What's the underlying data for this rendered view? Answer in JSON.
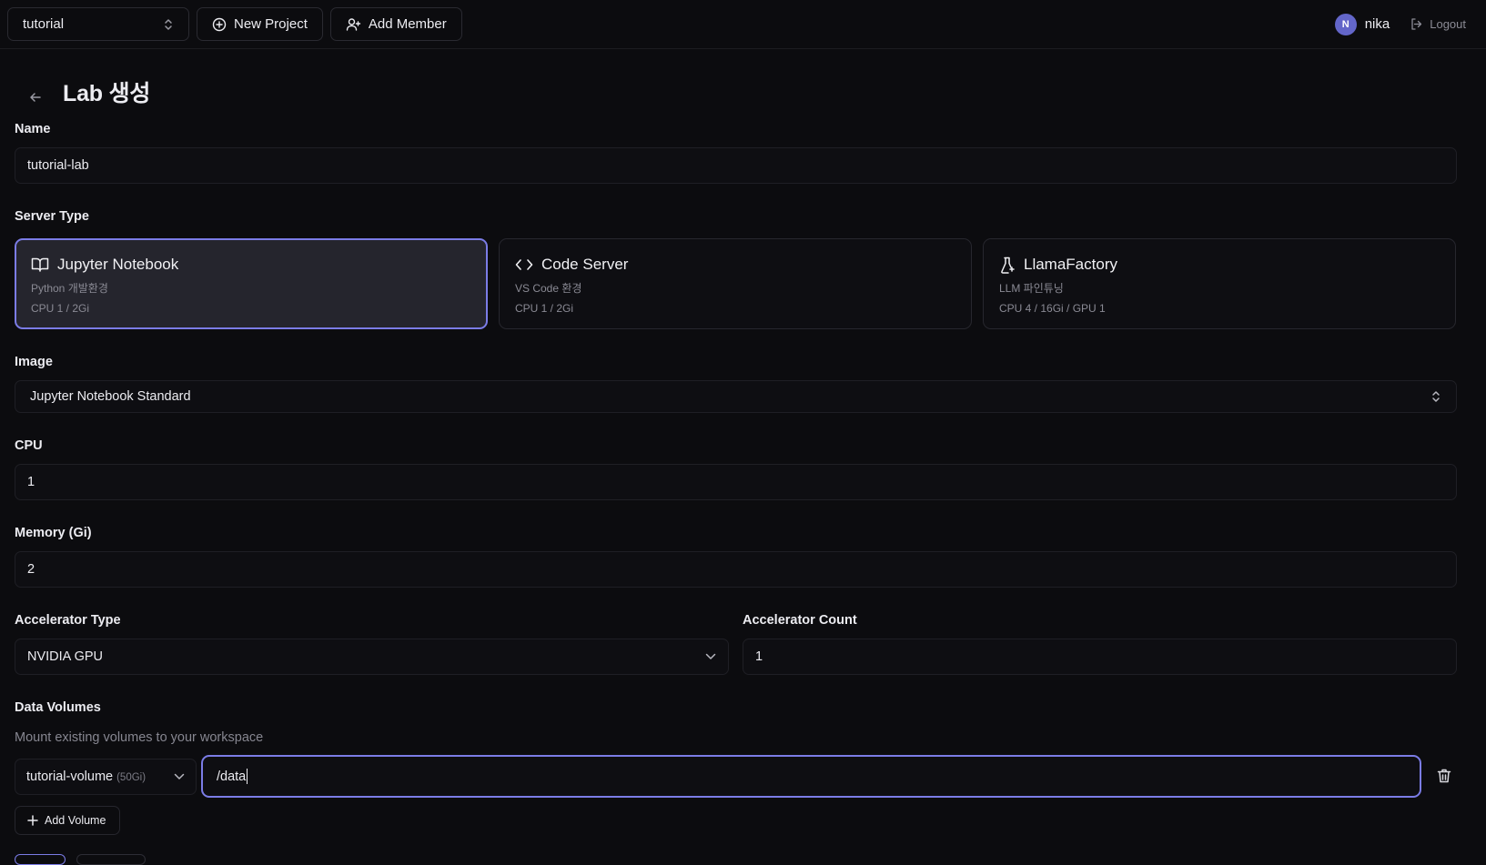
{
  "topbar": {
    "project": "tutorial",
    "new_project": "New Project",
    "add_member": "Add Member",
    "user_initial": "N",
    "user_name": "nika",
    "logout": "Logout"
  },
  "page": {
    "title": "Lab 생성"
  },
  "form": {
    "name_label": "Name",
    "name_value": "tutorial-lab",
    "server_type_label": "Server Type",
    "server_types": [
      {
        "name": "Jupyter Notebook",
        "description": "Python 개발환경",
        "spec": "CPU 1 / 2Gi",
        "icon": "book-open-icon",
        "selected": true
      },
      {
        "name": "Code Server",
        "description": "VS Code 환경",
        "spec": "CPU 1 / 2Gi",
        "icon": "code-icon",
        "selected": false
      },
      {
        "name": "LlamaFactory",
        "description": "LLM 파인튜닝",
        "spec": "CPU 4 / 16Gi / GPU 1",
        "icon": "flask-icon",
        "selected": false
      }
    ],
    "image_label": "Image",
    "image_value": "Jupyter Notebook Standard",
    "cpu_label": "CPU",
    "cpu_value": "1",
    "memory_label": "Memory (Gi)",
    "memory_value": "2",
    "accel_type_label": "Accelerator Type",
    "accel_type_value": "NVIDIA GPU",
    "accel_count_label": "Accelerator Count",
    "accel_count_value": "1",
    "volumes_label": "Data Volumes",
    "volumes_desc": "Mount existing volumes to your workspace",
    "volume_name": "tutorial-volume",
    "volume_size": "(50Gi)",
    "mount_path": "/data",
    "add_volume": "Add Volume"
  },
  "colors": {
    "accent": "#7b7ce6",
    "avatar": "#6366c9",
    "background": "#0c0c0f"
  }
}
